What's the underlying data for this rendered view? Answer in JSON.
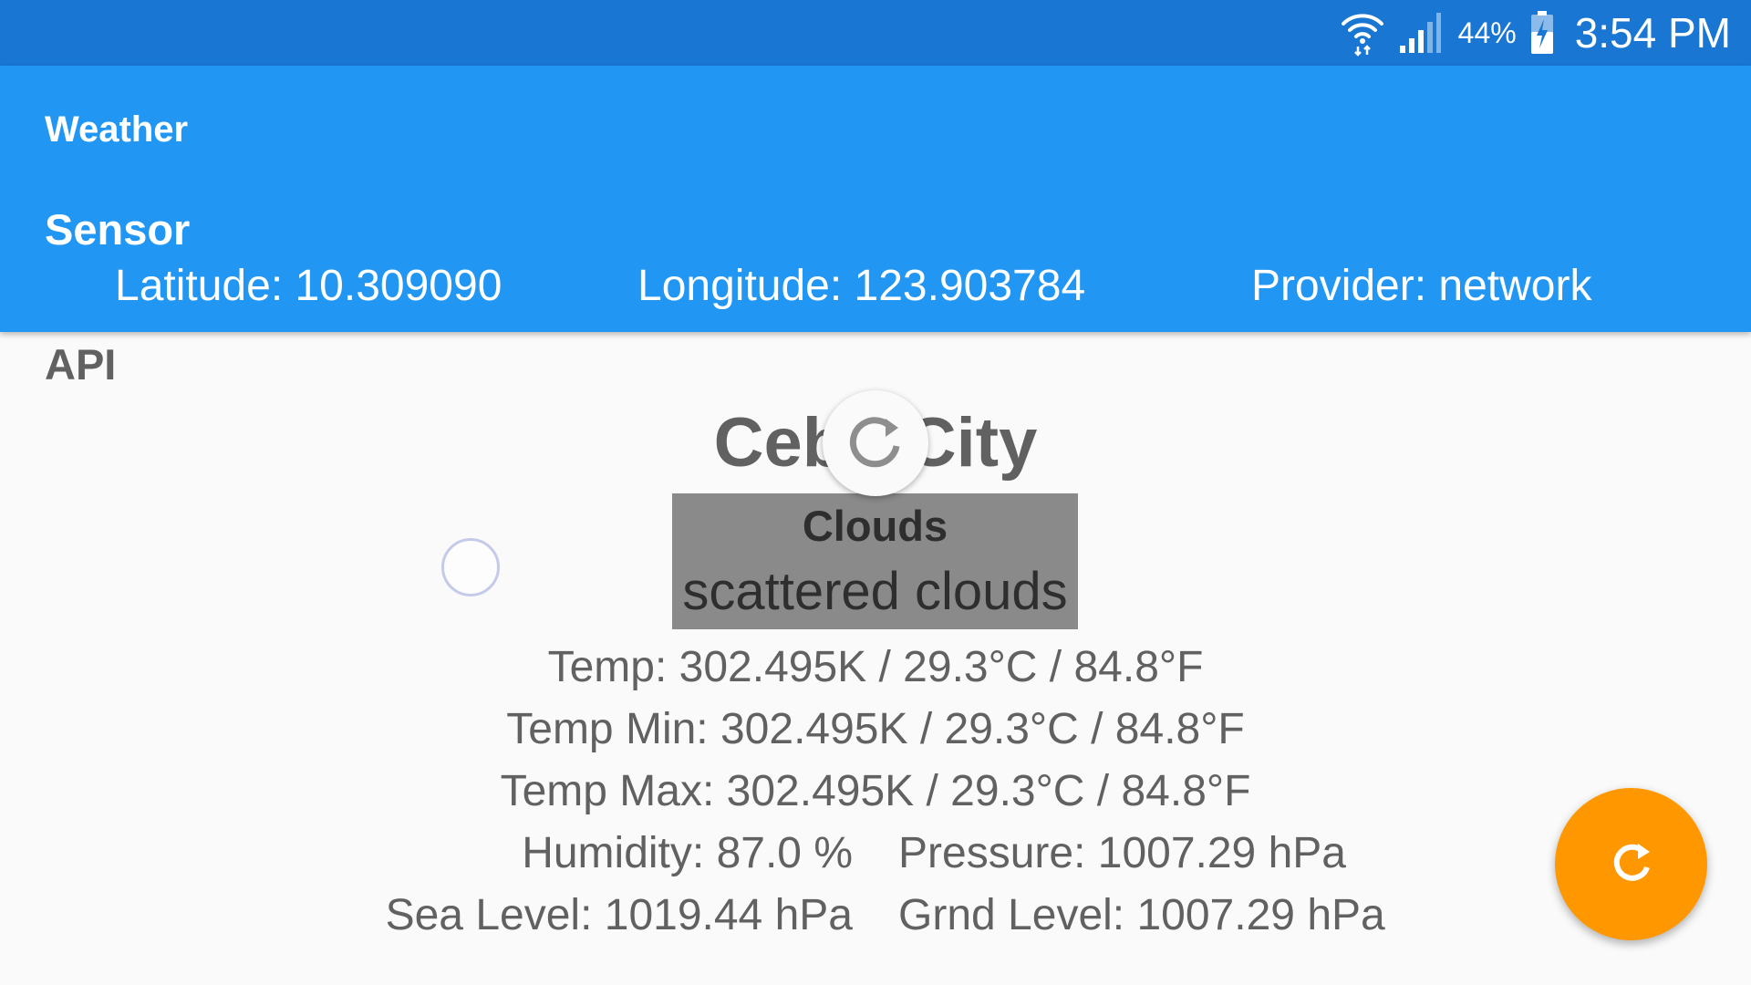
{
  "status_bar": {
    "battery_percent": "44%",
    "time": "3:54 PM",
    "icons": [
      "wifi-icon",
      "signal-icon",
      "battery-charging-icon"
    ]
  },
  "app_bar": {
    "title": "Weather",
    "sensor_heading": "Sensor",
    "latitude": "Latitude: 10.309090",
    "longitude": "Longitude: 123.903784",
    "provider": "Provider: network"
  },
  "api": {
    "heading": "API",
    "city": "Cebu City",
    "weather_main": "Clouds",
    "weather_description": "scattered clouds",
    "temp": "Temp: 302.495K / 29.3°C / 84.8°F",
    "temp_min": "Temp Min: 302.495K / 29.3°C / 84.8°F",
    "temp_max": "Temp Max: 302.495K / 29.3°C / 84.8°F",
    "humidity": "Humidity: 87.0 %",
    "pressure": "Pressure: 1007.29 hPa",
    "sea_level": "Sea Level: 1019.44 hPa",
    "grnd_level": "Grnd Level: 1007.29 hPa"
  },
  "controls": {
    "refresh_indicator_icon": "refresh-icon",
    "fab_icon": "refresh-icon"
  },
  "colors": {
    "status_bar": "#1976d2",
    "app_bar": "#2196f3",
    "fab": "#ff9800",
    "background": "#fafafa",
    "text_gray": "#616161",
    "weather_box": "#8a8a8a"
  }
}
